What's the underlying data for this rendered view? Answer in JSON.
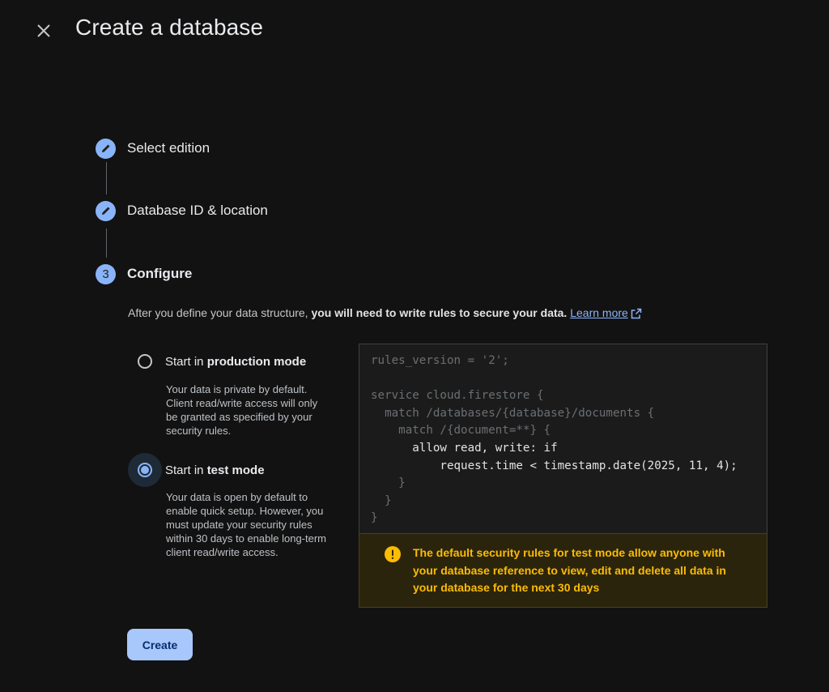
{
  "header": {
    "title": "Create a database"
  },
  "steps": [
    {
      "label": "Select edition",
      "state": "completed",
      "icon": "pencil-icon"
    },
    {
      "label": "Database ID & location",
      "state": "completed",
      "icon": "pencil-icon"
    },
    {
      "label": "Configure",
      "state": "active",
      "number": "3"
    }
  ],
  "configure": {
    "description_prefix": "After you define your data structure, ",
    "description_bold": "you will need to write rules to secure your data.",
    "learn_more": "Learn more",
    "options": [
      {
        "label_prefix": "Start in ",
        "label_bold": "production mode",
        "help": "Your data is private by default. Client read/write access will only be granted as specified by your security rules.",
        "selected": false
      },
      {
        "label_prefix": "Start in ",
        "label_bold": "test mode",
        "help": "Your data is open by default to enable quick setup. However, you must update your security rules within 30 days to enable long-term client read/write access.",
        "selected": true
      }
    ],
    "code": {
      "line1": "rules_version = '2';",
      "line2": "",
      "line3": "service cloud.firestore {",
      "line4": "  match /databases/{database}/documents {",
      "line5": "    match /{document=**} {",
      "line6": "      allow read, write: if",
      "line7": "          request.time < timestamp.date(2025, 11, 4);",
      "line8": "    }",
      "line9": "  }",
      "line10": "}"
    },
    "warning": "The default security rules for test mode allow anyone with your database reference to view, edit and delete all data in your database for the next 30 days"
  },
  "actions": {
    "create_label": "Create"
  },
  "colors": {
    "accent": "#8ab4f8",
    "warning": "#fbbc04",
    "background": "#121212"
  }
}
